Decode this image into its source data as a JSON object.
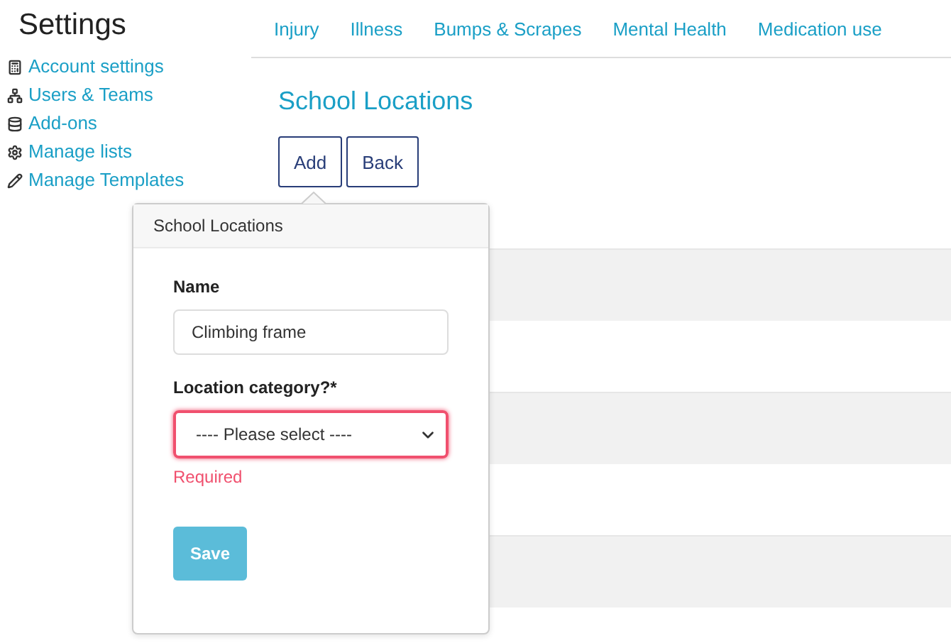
{
  "sidebar": {
    "title": "Settings",
    "items": [
      {
        "label": "Account settings"
      },
      {
        "label": "Users & Teams"
      },
      {
        "label": "Add-ons"
      },
      {
        "label": "Manage lists"
      },
      {
        "label": "Manage Templates"
      }
    ]
  },
  "tabs": [
    "Injury",
    "Illness",
    "Bumps & Scrapes",
    "Mental Health",
    "Medication use"
  ],
  "page_title": "School Locations",
  "buttons": [
    "Add",
    "Back"
  ],
  "popover": {
    "title": "School Locations",
    "fields": [
      {
        "kind": "text",
        "label": "Name",
        "value": "Climbing frame",
        "invalid": false
      },
      {
        "kind": "select",
        "label": "Location category?*",
        "value": "---- Please select ----",
        "invalid": true,
        "error": "Required"
      }
    ],
    "save": "Save"
  }
}
